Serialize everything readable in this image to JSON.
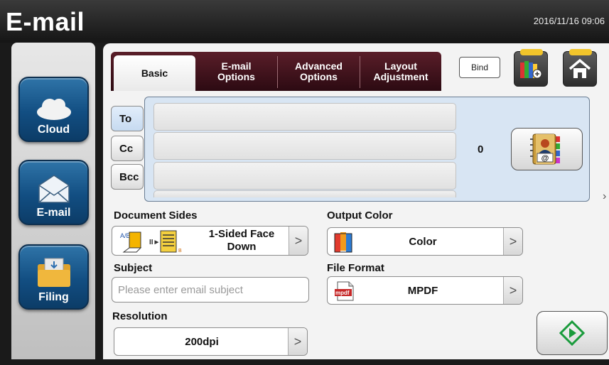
{
  "header": {
    "title": "E-mail",
    "datetime": "2016/11/16 09:06"
  },
  "sidebar": {
    "items": [
      {
        "label": "Cloud",
        "icon": "cloud-icon"
      },
      {
        "label": "E-mail",
        "icon": "envelope-icon"
      },
      {
        "label": "Filing",
        "icon": "folder-icon"
      }
    ]
  },
  "tabs": [
    {
      "line1": "Basic",
      "line2": ""
    },
    {
      "line1": "E-mail",
      "line2": "Options"
    },
    {
      "line1": "Advanced",
      "line2": "Options"
    },
    {
      "line1": "Layout",
      "line2": "Adjustment"
    }
  ],
  "toolbar": {
    "bind_label": "Bind",
    "scan_preview_icon": "scan-preview-icon",
    "home_icon": "home-icon"
  },
  "recipients": {
    "to_label": "To",
    "cc_label": "Cc",
    "bcc_label": "Bcc",
    "to_value": "",
    "cc_value": "",
    "bcc_value": "",
    "count": "0",
    "address_book_icon": "address-book-icon"
  },
  "document_sides": {
    "label": "Document Sides",
    "value_line1": "1-Sided Face",
    "value_line2": "Down"
  },
  "output_color": {
    "label": "Output Color",
    "value": "Color"
  },
  "subject": {
    "label": "Subject",
    "placeholder": "Please enter email subject"
  },
  "file_format": {
    "label": "File Format",
    "value": "MPDF",
    "badge": "mpdf"
  },
  "resolution": {
    "label": "Resolution",
    "value": "200dpi"
  },
  "colors": {
    "tab_bar": "#4a1520",
    "sidebar_button": "#124e82",
    "start_icon": "#1a9b3c",
    "recipient_panel": "#d8e5f3"
  }
}
